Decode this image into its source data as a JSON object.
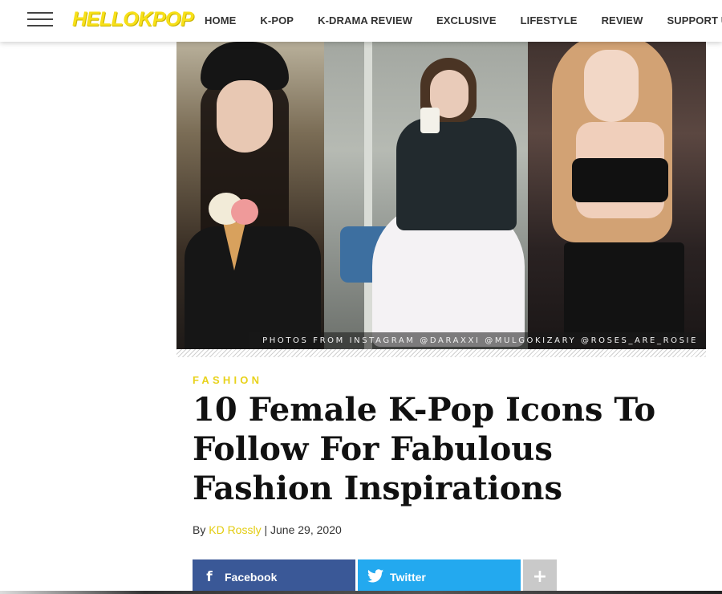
{
  "header": {
    "logo": "HELLOKPOP",
    "nav": [
      "HOME",
      "K-POP",
      "K-DRAMA REVIEW",
      "EXCLUSIVE",
      "LIFESTYLE",
      "REVIEW",
      "SUPPORT US"
    ]
  },
  "hero": {
    "caption": "PHOTOS FROM INSTAGRAM @DARAXXI @MULGOKIZARY @ROSES_ARE_ROSIE"
  },
  "article": {
    "category": "FASHION",
    "title": "10 Female K-Pop Icons To Follow For Fabulous Fashion Inspirations",
    "by": "By",
    "author": "KD Rossly",
    "separator": "|",
    "date": "June 29, 2020"
  },
  "share": {
    "facebook": "Facebook",
    "twitter": "Twitter",
    "facebook_icon": "facebook-icon",
    "twitter_icon": "twitter-icon",
    "more_icon": "plus-icon"
  },
  "colors": {
    "accent": "#f7e019",
    "facebook": "#3a5897",
    "twitter": "#23a9ef",
    "more": "#c9c9c9"
  }
}
